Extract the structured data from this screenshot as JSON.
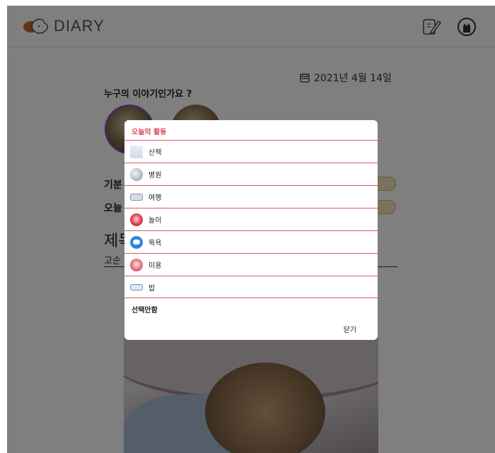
{
  "header": {
    "logo_text": "DIARY",
    "icons": [
      "write-icon",
      "profile-icon"
    ]
  },
  "diary": {
    "date_text": "2021년 4월 14일",
    "question": "누구의 이야기인가요 ?",
    "mood_label": "기분",
    "today_label": "오늘",
    "title_label": "제목",
    "title_value": "고순"
  },
  "modal": {
    "title": "오늘의 활동",
    "items": [
      {
        "label": "산책",
        "icon": "walk-icon"
      },
      {
        "label": "병원",
        "icon": "hospital-icon"
      },
      {
        "label": "여행",
        "icon": "car-icon"
      },
      {
        "label": "놀이",
        "icon": "play-icon"
      },
      {
        "label": "목욕",
        "icon": "bath-icon"
      },
      {
        "label": "미용",
        "icon": "grooming-icon"
      },
      {
        "label": "밥",
        "icon": "food-icon"
      }
    ],
    "none_label": "선택안함",
    "close_label": "닫기"
  },
  "colors": {
    "accent": "#e0455a",
    "divider": "#e45468",
    "pill": "#f4e5b9",
    "pet_ring": "#6b5be0"
  }
}
